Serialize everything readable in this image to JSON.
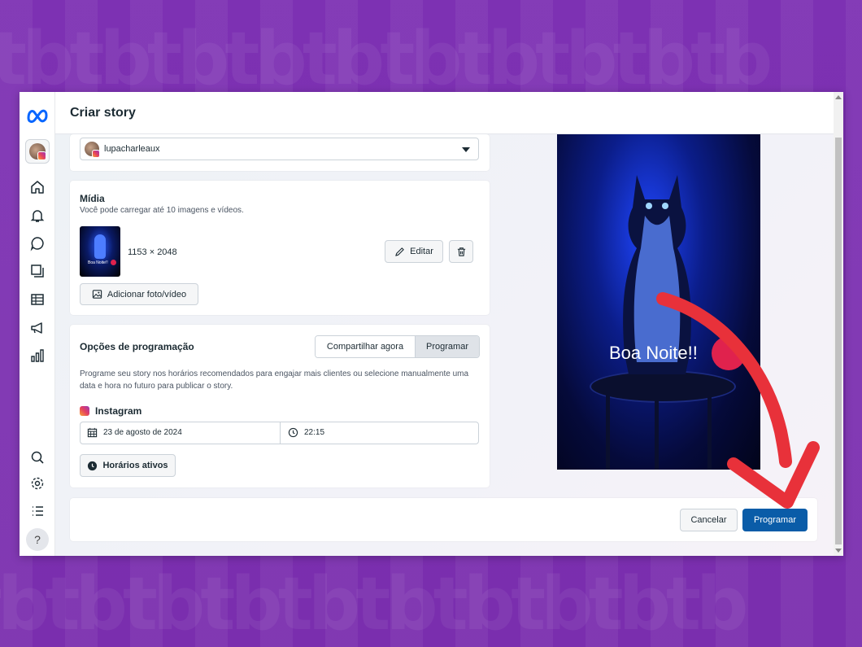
{
  "window": {
    "title": "Criar story"
  },
  "account": {
    "name": "lupacharleaux"
  },
  "sidebar": {
    "icons": [
      "meta-logo",
      "account-avatar",
      "home-icon",
      "bell-icon",
      "chat-icon",
      "pages-icon",
      "table-icon",
      "megaphone-icon",
      "bar-chart-icon",
      "search-icon",
      "gear-icon",
      "menu-icon",
      "help-icon"
    ],
    "help_label": "?"
  },
  "media": {
    "title": "Mídia",
    "subtitle": "Você pode carregar até 10 imagens e vídeos.",
    "dimensions": "1153 × 2048",
    "edit_label": "Editar",
    "add_label": "Adicionar foto/vídeo",
    "thumb_caption": "Boa Noite!!"
  },
  "scheduling": {
    "title": "Opções de programação",
    "tabs": [
      "Compartilhar agora",
      "Programar"
    ],
    "selected_tab": "Programar",
    "description": "Programe seu story nos horários recomendados para engajar mais clientes ou selecione manualmente uma data e hora no futuro para publicar o story.",
    "platform": "Instagram",
    "date": "23 de agosto de 2024",
    "time": "22:15",
    "active_hours_label": "Horários ativos"
  },
  "preview": {
    "caption": "Boa Noite!!"
  },
  "footer": {
    "cancel_label": "Cancelar",
    "submit_label": "Programar"
  },
  "colors": {
    "primary": "#0a5ca8",
    "background": "#7b2fb0",
    "arrow": "#e8313a"
  }
}
